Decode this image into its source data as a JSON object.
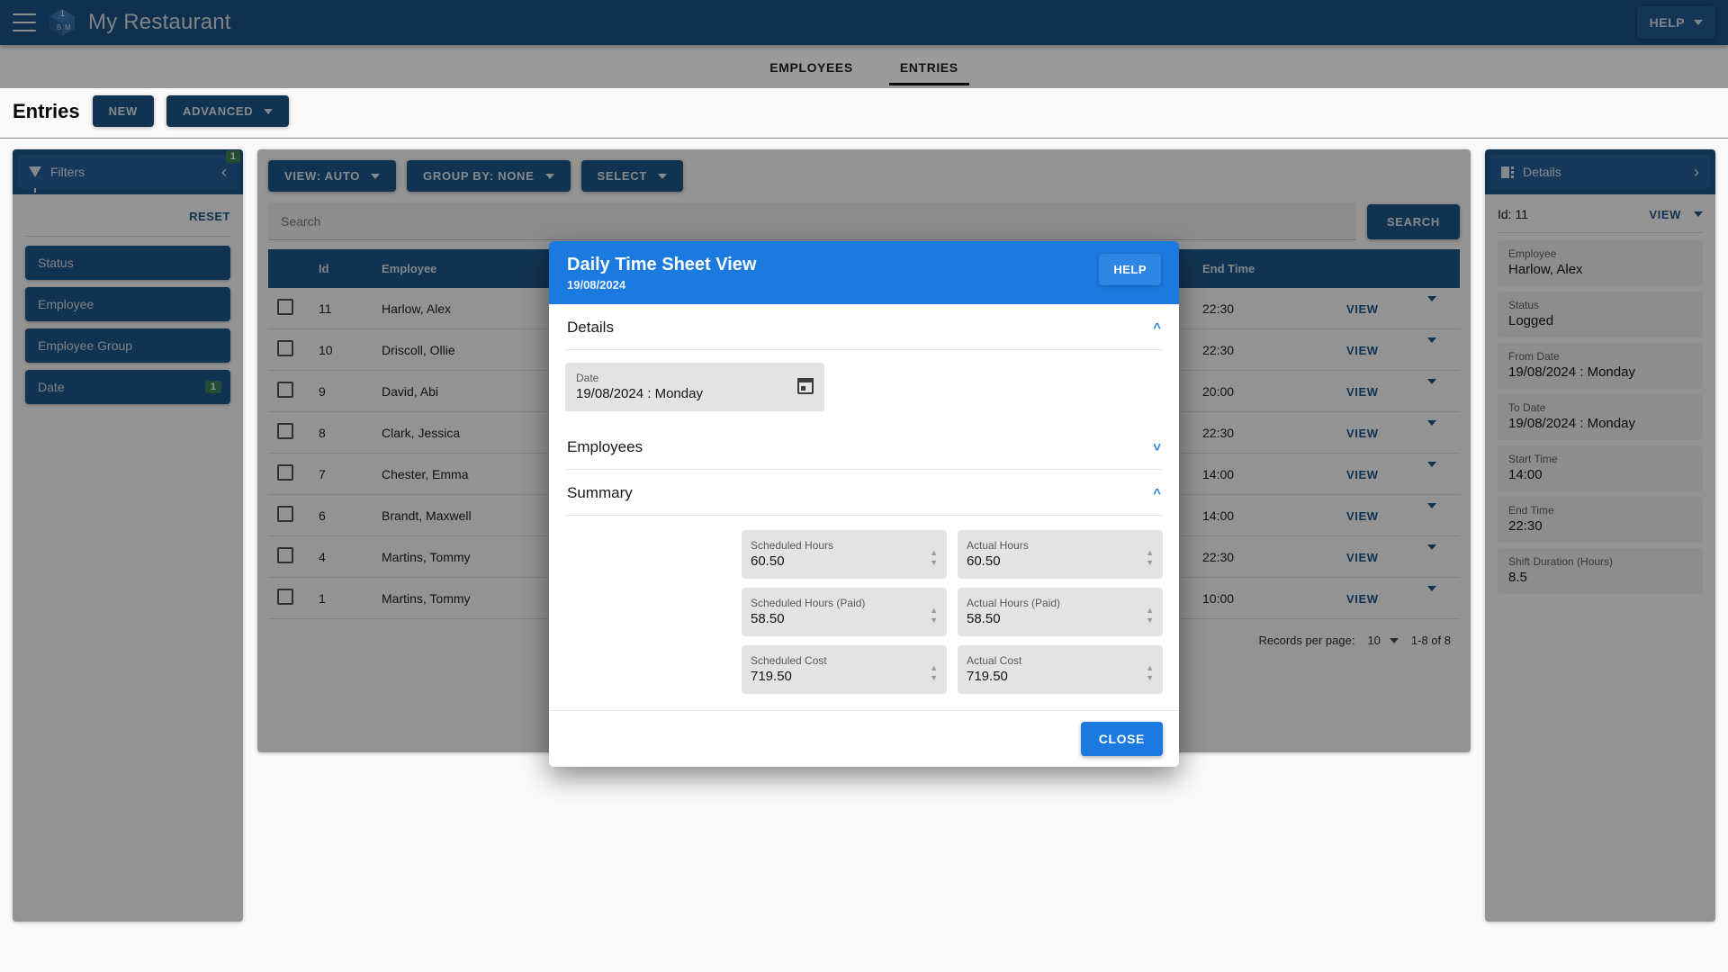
{
  "appbar": {
    "title": "My Restaurant",
    "help_label": "HELP",
    "logo_badge": "1",
    "logo_letter_left": "B",
    "logo_letter_right": "M"
  },
  "tabs": [
    {
      "label": "EMPLOYEES",
      "active": false
    },
    {
      "label": "ENTRIES",
      "active": true
    }
  ],
  "page_header": {
    "title": "Entries",
    "new_label": "NEW",
    "advanced_label": "ADVANCED"
  },
  "filters": {
    "panel_title": "Filters",
    "badge": "1",
    "reset_label": "RESET",
    "items": [
      {
        "label": "Status",
        "badge": ""
      },
      {
        "label": "Employee",
        "badge": ""
      },
      {
        "label": "Employee Group",
        "badge": ""
      },
      {
        "label": "Date",
        "badge": "1"
      }
    ]
  },
  "grid": {
    "toolbar": [
      {
        "label": "VIEW: AUTO"
      },
      {
        "label": "GROUP BY: NONE"
      },
      {
        "label": "SELECT"
      }
    ],
    "search_placeholder": "Search",
    "search_value": "",
    "search_button": "SEARCH",
    "columns": [
      "",
      "Id",
      "Employee",
      "End Time",
      "",
      ""
    ],
    "rows": [
      {
        "id": "11",
        "employee": "Harlow, Alex",
        "end_time": "22:30",
        "action": "VIEW"
      },
      {
        "id": "10",
        "employee": "Driscoll, Ollie",
        "end_time": "22:30",
        "action": "VIEW"
      },
      {
        "id": "9",
        "employee": "David, Abi",
        "end_time": "20:00",
        "action": "VIEW"
      },
      {
        "id": "8",
        "employee": "Clark, Jessica",
        "end_time": "22:30",
        "action": "VIEW"
      },
      {
        "id": "7",
        "employee": "Chester, Emma",
        "end_time": "14:00",
        "action": "VIEW"
      },
      {
        "id": "6",
        "employee": "Brandt, Maxwell",
        "end_time": "14:00",
        "action": "VIEW"
      },
      {
        "id": "4",
        "employee": "Martins, Tommy",
        "end_time": "22:30",
        "action": "VIEW"
      },
      {
        "id": "1",
        "employee": "Martins, Tommy",
        "end_time": "10:00",
        "action": "VIEW"
      }
    ],
    "pager": {
      "records_label": "Records per page:",
      "records_value": "10",
      "range": "1-8 of 8"
    }
  },
  "details": {
    "panel_title": "Details",
    "id_label": "Id: 11",
    "view_label": "VIEW",
    "fields": [
      {
        "label": "Employee",
        "value": "Harlow, Alex"
      },
      {
        "label": "Status",
        "value": "Logged"
      },
      {
        "label": "From Date",
        "value": "19/08/2024 : Monday"
      },
      {
        "label": "To Date",
        "value": "19/08/2024 : Monday"
      },
      {
        "label": "Start Time",
        "value": "14:00"
      },
      {
        "label": "End Time",
        "value": "22:30"
      },
      {
        "label": "Shift Duration (Hours)",
        "value": "8.5"
      }
    ]
  },
  "modal": {
    "title": "Daily Time Sheet View",
    "subtitle": "19/08/2024",
    "help_label": "HELP",
    "sections": {
      "details_title": "Details",
      "employees_title": "Employees",
      "summary_title": "Summary"
    },
    "date_field": {
      "label": "Date",
      "value": "19/08/2024 : Monday"
    },
    "summary_fields": [
      {
        "label": "Scheduled Hours",
        "value": "60.50"
      },
      {
        "label": "Actual Hours",
        "value": "60.50"
      },
      {
        "label": "Scheduled Hours (Paid)",
        "value": "58.50"
      },
      {
        "label": "Actual Hours (Paid)",
        "value": "58.50"
      },
      {
        "label": "Scheduled Cost",
        "value": "719.50"
      },
      {
        "label": "Actual Cost",
        "value": "719.50"
      }
    ],
    "close_label": "CLOSE"
  },
  "colors": {
    "appbar": "#124e8c",
    "primary": "#14538f",
    "modal_accent": "#1a7ae0",
    "badge_green": "#2f7d4f"
  }
}
